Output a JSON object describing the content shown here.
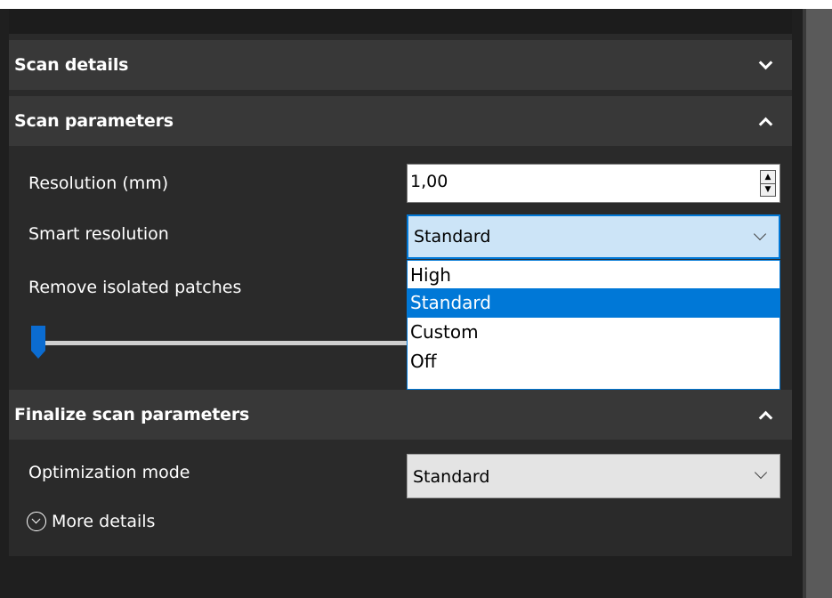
{
  "sections": {
    "scan_details": {
      "title": "Scan details",
      "expanded": false
    },
    "scan_parameters": {
      "title": "Scan parameters",
      "expanded": true,
      "resolution_label": "Resolution (mm)",
      "resolution_value": "1,00",
      "smart_resolution_label": "Smart resolution",
      "smart_resolution_value": "Standard",
      "smart_resolution_options": [
        "High",
        "Standard",
        "Custom",
        "Off"
      ],
      "remove_isolated_label": "Remove isolated patches",
      "remove_isolated_level": 0
    },
    "finalize": {
      "title": "Finalize scan parameters",
      "expanded": true,
      "optimization_label": "Optimization mode",
      "optimization_value": "Standard",
      "more_details_label": "More details"
    }
  },
  "icons": {
    "collapse": "chevron-up-icon",
    "expand": "chevron-down-icon",
    "more_details": "circle-chevron-down-icon"
  },
  "colors": {
    "accent": "#0078d7",
    "header_bg": "#383838",
    "panel_bg": "#2a2a2a"
  }
}
